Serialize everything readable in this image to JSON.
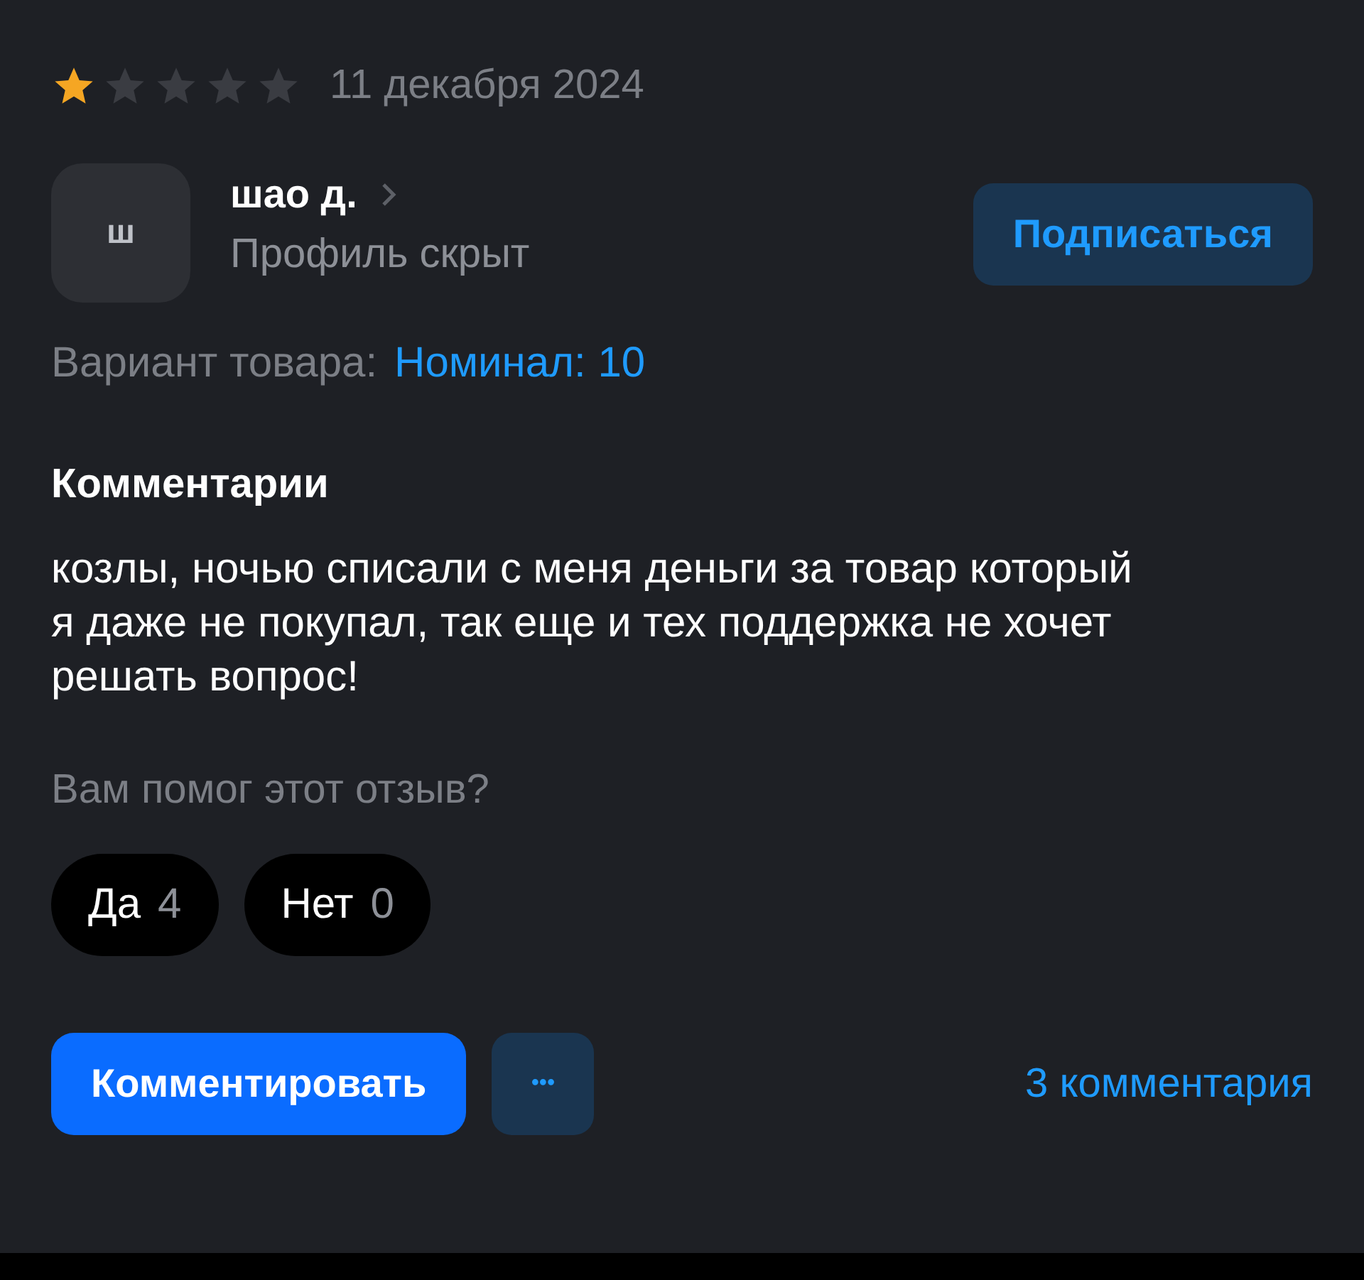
{
  "review": {
    "stars": 1,
    "date": "11 декабря 2024"
  },
  "author": {
    "initial": "ш",
    "name": "шао д.",
    "subtitle": "Профиль скрыт",
    "subscribe": "Подписаться"
  },
  "variant": {
    "label": "Вариант товара:",
    "value": "Номинал: 10"
  },
  "comments_heading": "Комментарии",
  "text": "козлы, ночью списали с меня деньги за товар который я даже не покупал, так еще и тех поддержка не хочет решать вопрос!",
  "helpful": {
    "question": "Вам помог этот отзыв?",
    "votes": [
      {
        "label": "Да",
        "count": "4"
      },
      {
        "label": "Нет",
        "count": "0"
      }
    ]
  },
  "actions": {
    "comment": "Комментировать",
    "more": "•••",
    "comments_link": "3 комментария"
  }
}
